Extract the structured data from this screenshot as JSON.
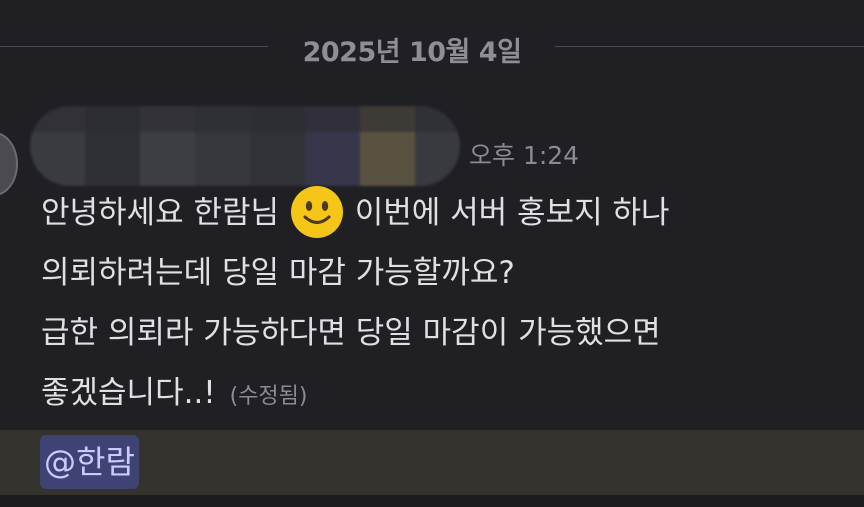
{
  "date_divider": {
    "label": "2025년 10월 4일"
  },
  "message": {
    "timestamp": "오후 1:24",
    "lines": {
      "line1_before_emoji": "안녕하세요 한람님",
      "line1_after_emoji": "이번에 서버 홍보지 하나",
      "line2": "의뢰하려는데 당일 마감 가능할까요?",
      "line3": "급한 의뢰라 가능하다면 당일 마감이 가능했으면",
      "line4": "좋겠습니다..!"
    },
    "emoji_icon": "slightly-smiling-face-icon",
    "edited_label": "(수정됨)",
    "mention": "@한람"
  },
  "colors": {
    "background": "#1f1f24",
    "mention_row_highlight": "#35332e",
    "mention_pill": "#3f4374",
    "mention_text": "#c7cbff",
    "muted_text": "#8a8b93",
    "emoji_yellow": "#f5c518"
  }
}
